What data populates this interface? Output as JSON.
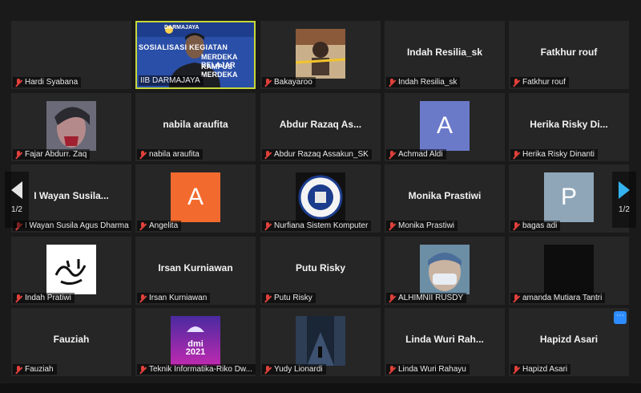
{
  "pager": {
    "left_label": "1/2",
    "right_label": "1/2"
  },
  "colors": {
    "mic_muted": "#e0413a",
    "active_border": "#c8d83a",
    "tile_bg": "#262626"
  },
  "tiles": [
    {
      "name": "Hardi Syabana",
      "center": ""
    },
    {
      "name": "IIB DARMAJAYA",
      "center": "",
      "video": true,
      "banner_lines": [
        "SOSIALISASI KEGIATAN",
        "MERDEKA BELAJAR",
        "KAMPUS MERDEKA"
      ],
      "banner_brand": "DARMAJAYA"
    },
    {
      "name": "Bakayaroo",
      "center": ""
    },
    {
      "name": "Indah Resilia_sk",
      "center": "Indah Resilia_sk"
    },
    {
      "name": "Fatkhur rouf",
      "center": "Fatkhur rouf"
    },
    {
      "name": "Fajar Abdurr. Zaq",
      "center": ""
    },
    {
      "name": "nabila araufita",
      "center": "nabila araufita"
    },
    {
      "name": "Abdur Razaq Assakun_SK",
      "center": "Abdur Razaq As..."
    },
    {
      "name": "Achmad Aldi",
      "center": "",
      "letter": "A",
      "letter_color": "#6b79c9"
    },
    {
      "name": "Herika Risky Dinanti",
      "center": "Herika Risky Di..."
    },
    {
      "name": "I Wayan Susila Agus Dharma",
      "center": "I Wayan Susila..."
    },
    {
      "name": "Angelita",
      "center": "",
      "letter": "A",
      "letter_color": "#f36a2e"
    },
    {
      "name": "Nurfiana Sistem Komputer",
      "center": ""
    },
    {
      "name": "Monika Prastiwi",
      "center": "Monika Prastiwi"
    },
    {
      "name": "bagas adi",
      "center": "",
      "letter": "P",
      "letter_color": "#8fa6b8"
    },
    {
      "name": "Indah Pratiwi",
      "center": ""
    },
    {
      "name": "Irsan Kurniawan",
      "center": "Irsan Kurniawan"
    },
    {
      "name": "Putu Risky",
      "center": "Putu Risky"
    },
    {
      "name": "ALHIMNII RUSDY",
      "center": ""
    },
    {
      "name": "amanda Mutiara Tantri",
      "center": ""
    },
    {
      "name": "Fauziah",
      "center": "Fauziah"
    },
    {
      "name": "Teknik Informatika-Riko Dw...",
      "center": "",
      "pic_text": "dmi 2021"
    },
    {
      "name": "Yudy Lionardi",
      "center": ""
    },
    {
      "name": "Linda Wuri Rahayu",
      "center": "Linda Wuri Rah..."
    },
    {
      "name": "Hapizd Asari",
      "center": "Hapizd Asari"
    }
  ]
}
